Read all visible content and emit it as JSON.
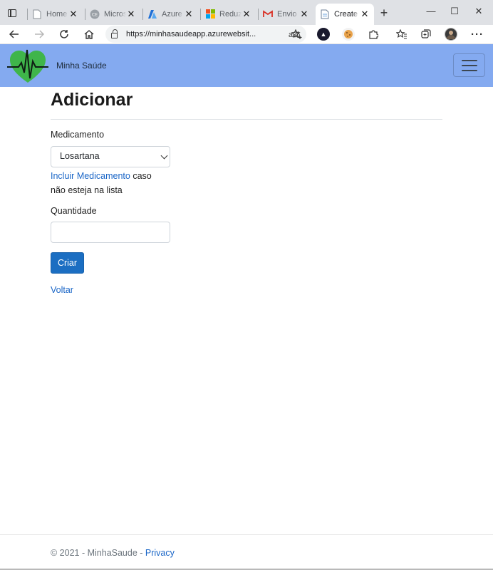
{
  "browser": {
    "tabs": [
      {
        "title": "Home",
        "active": false
      },
      {
        "title": "Microsoft",
        "active": false
      },
      {
        "title": "Azure",
        "active": false
      },
      {
        "title": "Reduza",
        "active": false
      },
      {
        "title": "Envio p",
        "active": false
      },
      {
        "title": "Create",
        "active": true
      }
    ],
    "close_glyph": "✕",
    "new_tab_glyph": "+",
    "window_controls": {
      "minimize": "—",
      "maximize": "☐",
      "close": "✕"
    },
    "address": {
      "url": "https://minhasaudeapp.azurewebsit...",
      "read_aloud_glyph": "aあ"
    },
    "nav_icons": [
      "back-icon",
      "forward-icon",
      "refresh-icon",
      "home-icon",
      "lock-icon",
      "favorite-add-icon",
      "extension-icon",
      "favorites-icon",
      "collections-icon",
      "profile-icon",
      "more-icon"
    ],
    "more_glyph": "···"
  },
  "navbar": {
    "brand": "Minha Saúde",
    "colors": {
      "background": "#84aaf0",
      "heart": "#3fb54a"
    }
  },
  "page": {
    "title": "Adicionar",
    "medicamento_label": "Medicamento",
    "medicamento_selected": "Losartana",
    "include_link": "Incluir Medicamento",
    "include_helper": "caso não esteja na lista",
    "quantidade_label": "Quantidade",
    "quantidade_value": "",
    "submit_label": "Criar",
    "back_link": "Voltar"
  },
  "footer": {
    "copyright": "© 2021 - MinhaSaude - ",
    "privacy_link": "Privacy"
  },
  "colors": {
    "primary": "#1b6ec2",
    "link": "#1a66c7"
  }
}
